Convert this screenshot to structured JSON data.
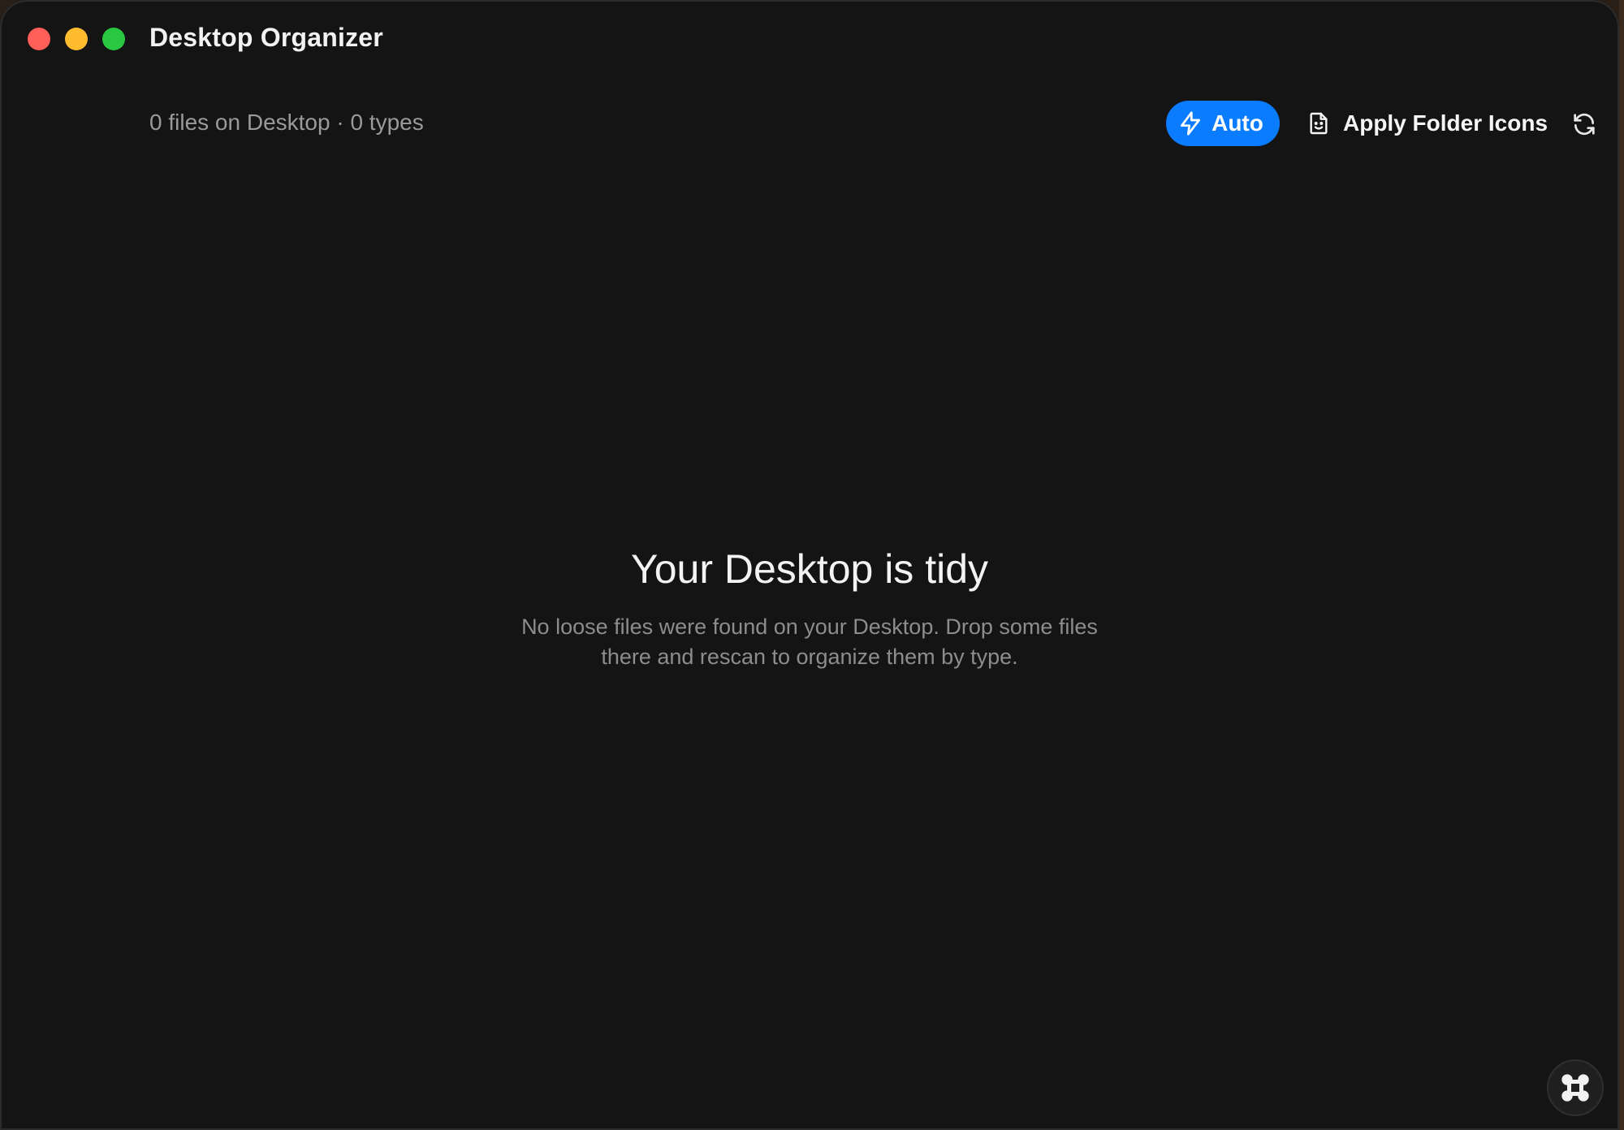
{
  "window": {
    "title": "Desktop Organizer"
  },
  "toolbar": {
    "status": "0 files on Desktop · 0 types",
    "auto_label": "Auto",
    "apply_label": "Apply Folder Icons"
  },
  "empty_state": {
    "title": "Your Desktop is tidy",
    "description": "No loose files were found on your Desktop. Drop some files there and rescan to organize them by type."
  },
  "colors": {
    "accent": "#0a7cff",
    "background": "#141414",
    "close": "#ff5f57",
    "minimize": "#febc2e",
    "maximize": "#28c840"
  },
  "icons": {
    "auto": "lightning-bolt-icon",
    "apply": "folder-face-icon",
    "refresh": "refresh-icon",
    "corner": "command-icon"
  }
}
